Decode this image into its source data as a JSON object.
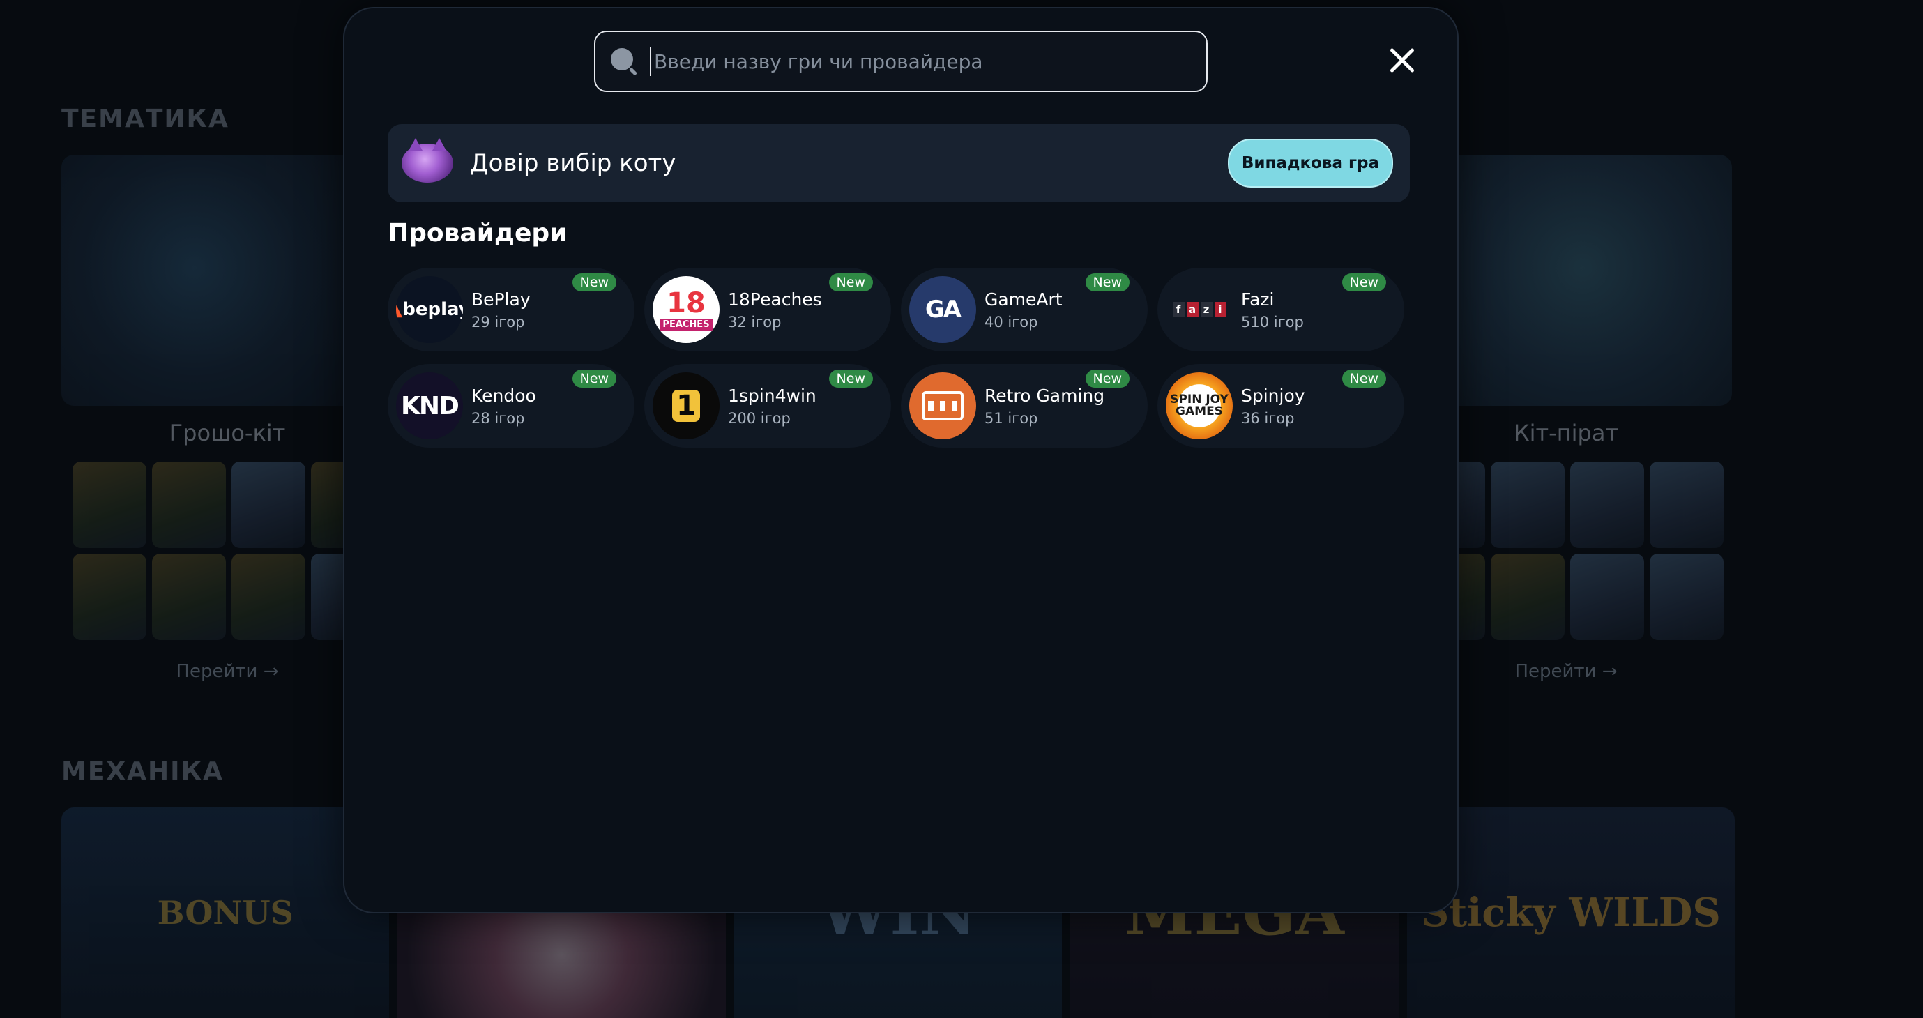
{
  "background": {
    "sections": [
      {
        "title": "ТЕМАТИКА"
      },
      {
        "title": "МЕХАНІКА"
      }
    ],
    "theme_cards": [
      {
        "name": "Грошо-кіт",
        "link": "Перейти →"
      },
      {
        "name": "Кіт-пірат",
        "link": "Перейти →"
      }
    ],
    "mechanics_tiles": [
      "BONUS",
      "",
      "WIN",
      "MEGA",
      "Sticky WILDS"
    ]
  },
  "search": {
    "placeholder": "Введи назву гри чи провайдера",
    "value": ""
  },
  "trust": {
    "label": "Довір вибір коту",
    "button": "Випадкова гра"
  },
  "providers": {
    "title": "Провайдери",
    "items": [
      {
        "name": "BePlay",
        "count": "29 ігор",
        "badge": "New",
        "logo_text": "beplay",
        "logo_icon": "beplay-logo"
      },
      {
        "name": "18Peaches",
        "count": "32 ігор",
        "badge": "New",
        "logo_text": "18",
        "logo_sub": "PEACHES",
        "logo_icon": "18peaches-logo"
      },
      {
        "name": "GameArt",
        "count": "40 ігор",
        "badge": "New",
        "logo_text": "GA",
        "logo_icon": "gameart-logo"
      },
      {
        "name": "Fazi",
        "count": "510 ігор",
        "badge": "New",
        "logo_text": "fazi",
        "logo_icon": "fazi-logo"
      },
      {
        "name": "Kendoo",
        "count": "28 ігор",
        "badge": "New",
        "logo_text": "KND",
        "logo_icon": "kendoo-logo"
      },
      {
        "name": "1spin4win",
        "count": "200 ігор",
        "badge": "New",
        "logo_text": "1",
        "logo_icon": "1spin4win-logo"
      },
      {
        "name": "Retro Gaming",
        "count": "51 ігор",
        "badge": "New",
        "logo_icon": "retro-gaming-logo"
      },
      {
        "name": "Spinjoy",
        "count": "36 ігор",
        "badge": "New",
        "logo_text": "SPIN JOY GAMES",
        "logo_icon": "spinjoy-logo"
      }
    ]
  },
  "colors": {
    "accent_button": "#7fd8e3",
    "new_badge": "#2f8a45",
    "modal_bg": "#0a1018"
  }
}
